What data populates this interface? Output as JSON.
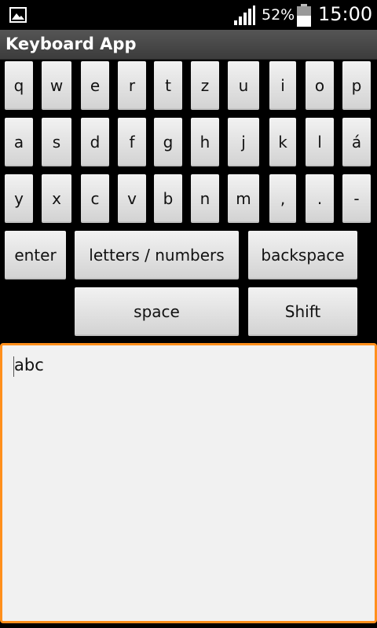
{
  "status_bar": {
    "battery_percent": "52%",
    "time": "15:00",
    "icons": [
      "gallery-icon",
      "signal-icon",
      "battery-icon"
    ]
  },
  "app": {
    "title": "Keyboard App"
  },
  "keyboard": {
    "row1": [
      "q",
      "w",
      "e",
      "r",
      "t",
      "z",
      "u",
      "i",
      "o",
      "p"
    ],
    "row2": [
      "a",
      "s",
      "d",
      "f",
      "g",
      "h",
      "j",
      "k",
      "l",
      "á"
    ],
    "row3": [
      "y",
      "x",
      "c",
      "v",
      "b",
      "n",
      "m",
      ",",
      ".",
      "-"
    ],
    "enter": "enter",
    "letters_numbers": "letters / numbers",
    "backspace": "backspace",
    "space": "space",
    "shift": "Shift"
  },
  "text_field": {
    "value": "abc"
  },
  "colors": {
    "focus_border": "#ff8f1c",
    "key_top": "#f2f2f2",
    "key_bottom": "#d2d2d2",
    "background": "#000000"
  }
}
